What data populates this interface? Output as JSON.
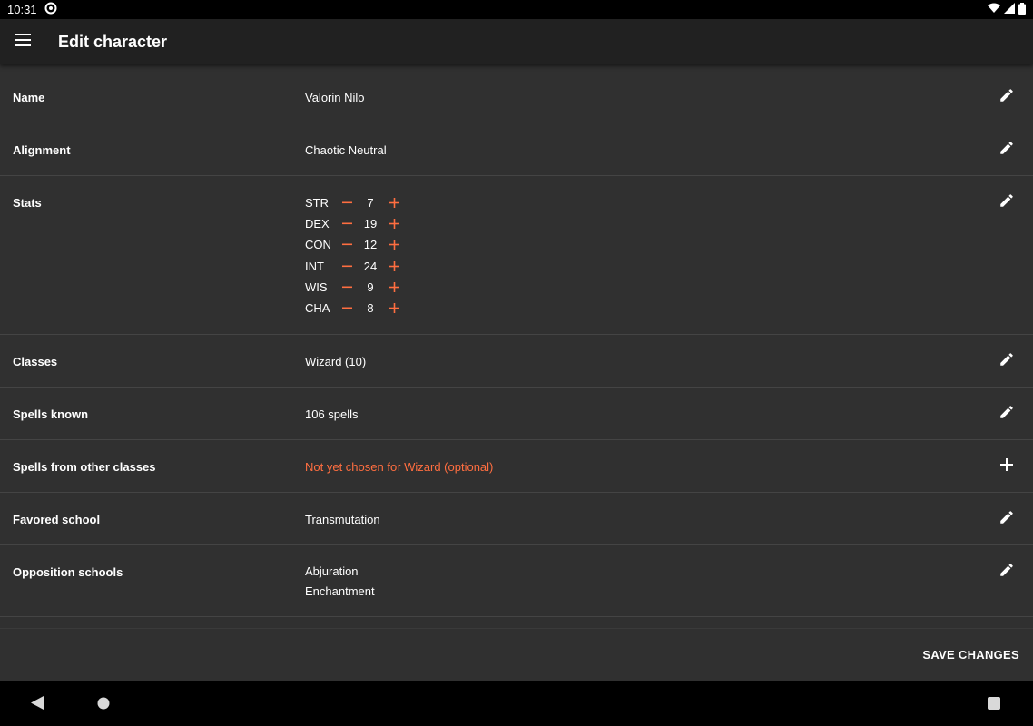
{
  "status_bar": {
    "time": "10:31"
  },
  "app_bar": {
    "title": "Edit character"
  },
  "colors": {
    "accent": "#ff6e40",
    "background": "#303030",
    "app_bar": "#212121",
    "divider": "#444444"
  },
  "rows": {
    "name": {
      "label": "Name",
      "value": "Valorin Nilo",
      "action_icon": "pencil-icon"
    },
    "alignment": {
      "label": "Alignment",
      "value": "Chaotic Neutral",
      "action_icon": "pencil-icon"
    },
    "stats": {
      "label": "Stats",
      "action_icon": "pencil-icon",
      "items": [
        {
          "name": "STR",
          "value": "7"
        },
        {
          "name": "DEX",
          "value": "19"
        },
        {
          "name": "CON",
          "value": "12"
        },
        {
          "name": "INT",
          "value": "24"
        },
        {
          "name": "WIS",
          "value": "9"
        },
        {
          "name": "CHA",
          "value": "8"
        }
      ]
    },
    "classes": {
      "label": "Classes",
      "value": "Wizard (10)",
      "action_icon": "pencil-icon"
    },
    "spells_known": {
      "label": "Spells known",
      "value": "106 spells",
      "action_icon": "pencil-icon"
    },
    "spells_other": {
      "label": "Spells from other classes",
      "value": "Not yet chosen for Wizard (optional)",
      "action_icon": "plus-icon"
    },
    "favored_school": {
      "label": "Favored school",
      "value": "Transmutation",
      "action_icon": "pencil-icon"
    },
    "opposition_schools": {
      "label": "Opposition schools",
      "values": [
        "Abjuration",
        "Enchantment"
      ],
      "action_icon": "pencil-icon"
    }
  },
  "bottom_bar": {
    "save_label": "SAVE CHANGES"
  }
}
